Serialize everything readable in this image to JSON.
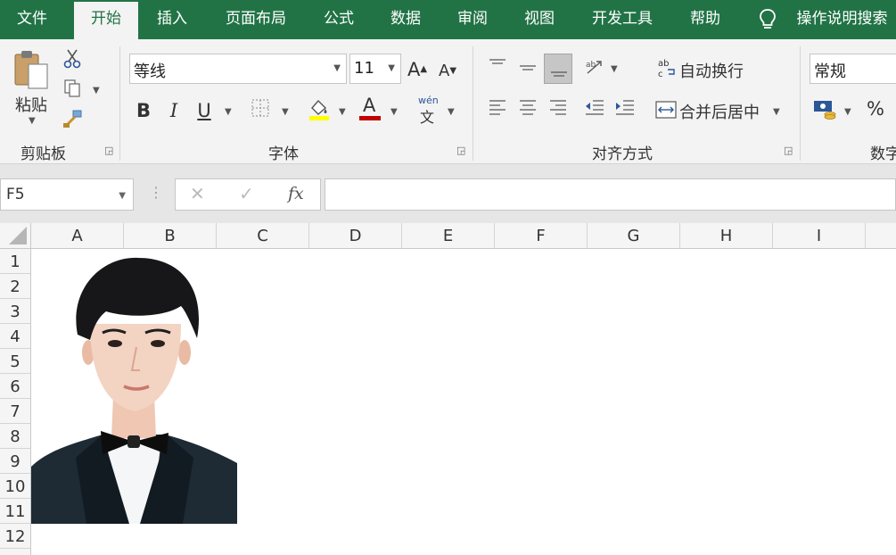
{
  "menu": {
    "tabs": [
      {
        "label": "文件"
      },
      {
        "label": "开始"
      },
      {
        "label": "插入"
      },
      {
        "label": "页面布局"
      },
      {
        "label": "公式"
      },
      {
        "label": "数据"
      },
      {
        "label": "审阅"
      },
      {
        "label": "视图"
      },
      {
        "label": "开发工具"
      },
      {
        "label": "帮助"
      }
    ],
    "active_tab": "开始",
    "tell_me": "操作说明搜索"
  },
  "ribbon": {
    "clipboard": {
      "paste_label": "粘贴",
      "group_label": "剪贴板"
    },
    "font": {
      "font_name": "等线",
      "font_size": "11",
      "grow_font": "A",
      "shrink_font": "A",
      "bold": "B",
      "italic": "I",
      "underline": "U",
      "phonetic_top": "wén",
      "phonetic_bottom": "文",
      "group_label": "字体"
    },
    "alignment": {
      "wrap_text": "自动换行",
      "merge_center": "合并后居中",
      "group_label": "对齐方式"
    },
    "number": {
      "format": "常规",
      "percent": "%",
      "group_label": "数字"
    }
  },
  "formula_bar": {
    "name_box": "F5",
    "fx": "fx",
    "formula": ""
  },
  "sheet": {
    "columns": [
      "A",
      "B",
      "C",
      "D",
      "E",
      "F",
      "G",
      "H",
      "I"
    ],
    "rows": [
      "1",
      "2",
      "3",
      "4",
      "5",
      "6",
      "7",
      "8",
      "9",
      "10",
      "11",
      "12"
    ]
  },
  "colors": {
    "accent": "#217346",
    "font_color": "#c00000",
    "fill_color": "#ffff00"
  },
  "icons": {
    "cut": "scissors-icon",
    "copy": "copy-icon",
    "format_painter": "paintbrush-icon",
    "tell_me": "lightbulb-icon",
    "cancel": "close-icon",
    "enter": "check-icon",
    "select_all": "select-all-icon"
  }
}
